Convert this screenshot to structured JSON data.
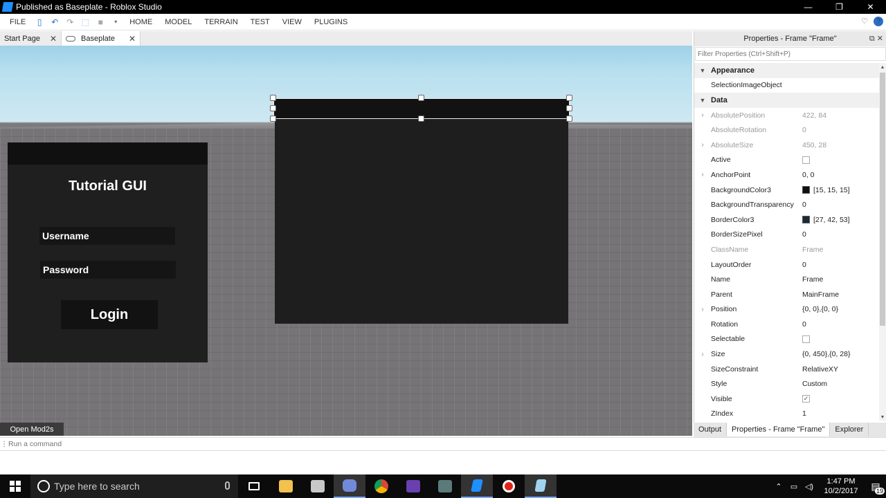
{
  "window": {
    "title": "Published as Baseplate - Roblox Studio",
    "minimize": "—",
    "restore": "❐",
    "close": "✕"
  },
  "menu": {
    "items": [
      "FILE",
      "HOME",
      "MODEL",
      "TERRAIN",
      "TEST",
      "VIEW",
      "PLUGINS"
    ]
  },
  "doc_tabs": [
    {
      "label": "Start Page",
      "close": "✕"
    },
    {
      "label": "Baseplate",
      "close": "✕"
    }
  ],
  "viewport": {
    "gui_title": "Tutorial GUI",
    "username": "Username",
    "password": "Password",
    "login": "Login",
    "mod_button": "Open Mod2s"
  },
  "properties": {
    "header": "Properties - Frame \"Frame\"",
    "filter_placeholder": "Filter Properties (Ctrl+Shift+P)",
    "sections": {
      "appearance": "Appearance",
      "data": "Data"
    },
    "appearance_rows": [
      {
        "name": "SelectionImageObject",
        "value": ""
      }
    ],
    "data_rows": [
      {
        "name": "AbsolutePosition",
        "value": "422, 84"
      },
      {
        "name": "AbsoluteRotation",
        "value": "0"
      },
      {
        "name": "AbsoluteSize",
        "value": "450, 28"
      },
      {
        "name": "Active",
        "value": ""
      },
      {
        "name": "AnchorPoint",
        "value": "0, 0"
      },
      {
        "name": "BackgroundColor3",
        "value": "[15, 15, 15]",
        "swatch": "#0f0f0f"
      },
      {
        "name": "BackgroundTransparency",
        "value": "0"
      },
      {
        "name": "BorderColor3",
        "value": "[27, 42, 53]",
        "swatch": "#1b2a35"
      },
      {
        "name": "BorderSizePixel",
        "value": "0"
      },
      {
        "name": "ClassName",
        "value": "Frame"
      },
      {
        "name": "LayoutOrder",
        "value": "0"
      },
      {
        "name": "Name",
        "value": "Frame"
      },
      {
        "name": "Parent",
        "value": "MainFrame"
      },
      {
        "name": "Position",
        "value": "{0, 0},{0, 0}"
      },
      {
        "name": "Rotation",
        "value": "0"
      },
      {
        "name": "Selectable",
        "value": ""
      },
      {
        "name": "Size",
        "value": "{0, 450},{0, 28}"
      },
      {
        "name": "SizeConstraint",
        "value": "RelativeXY"
      },
      {
        "name": "Style",
        "value": "Custom"
      },
      {
        "name": "Visible",
        "value": "✓"
      },
      {
        "name": "ZIndex",
        "value": "1"
      }
    ]
  },
  "bottom_tabs": [
    "Output",
    "Properties - Frame \"Frame\"",
    "Explorer"
  ],
  "command_bar": {
    "placeholder": "Run a command"
  },
  "taskbar": {
    "search_placeholder": "Type here to search",
    "time": "1:47 PM",
    "date": "10/2/2017",
    "notification_count": "19"
  }
}
